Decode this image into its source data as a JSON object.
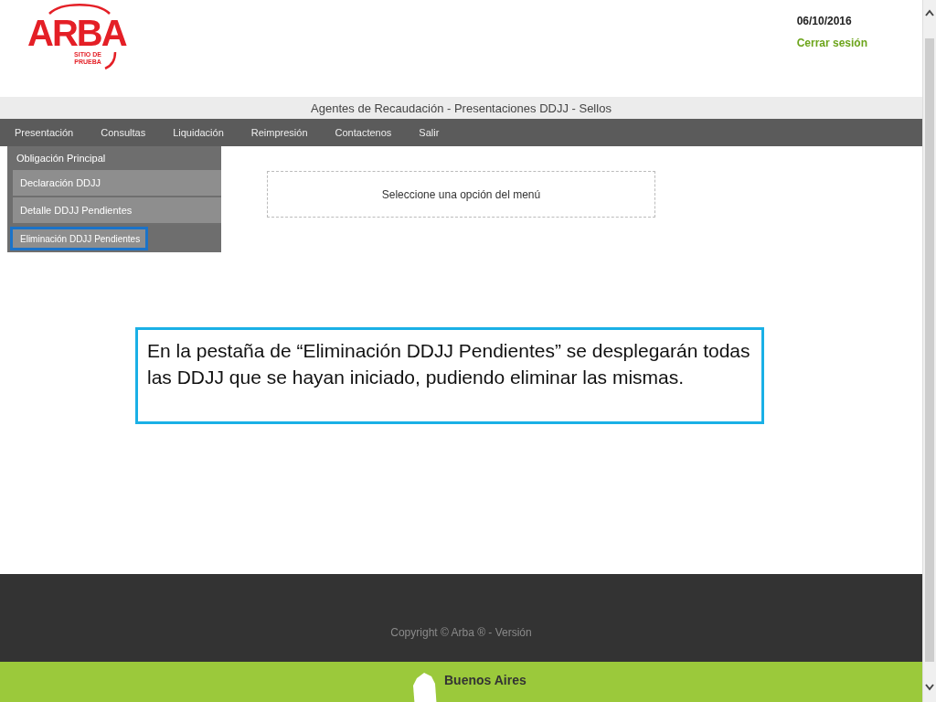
{
  "header": {
    "logo": {
      "text": "ARBA",
      "subtitle": "SITIO DE PRUEBA"
    },
    "date": "06/10/2016",
    "logout_link": "Cerrar sesión"
  },
  "title_bar": "Agentes de Recaudación - Presentaciones DDJJ - Sellos",
  "menu": [
    "Presentación",
    "Consultas",
    "Liquidación",
    "Reimpresión",
    "Contactenos",
    "Salir"
  ],
  "dropdown": {
    "heading": "Obligación Principal",
    "items": [
      {
        "label": "Declaración DDJJ",
        "selected": false
      },
      {
        "label": "Detalle DDJJ Pendientes",
        "selected": false
      },
      {
        "label": "Eliminación DDJJ Pendientes",
        "selected": true
      }
    ]
  },
  "content_message": "Seleccione una opción del menú",
  "callout": "En la pestaña de “Eliminación DDJJ Pendientes” se desplegarán todas las DDJJ que se hayan iniciado, pudiendo eliminar las mismas.",
  "footer": {
    "copyright": "Copyright © Arba ® - Versión",
    "brand": "Buenos Aires"
  }
}
